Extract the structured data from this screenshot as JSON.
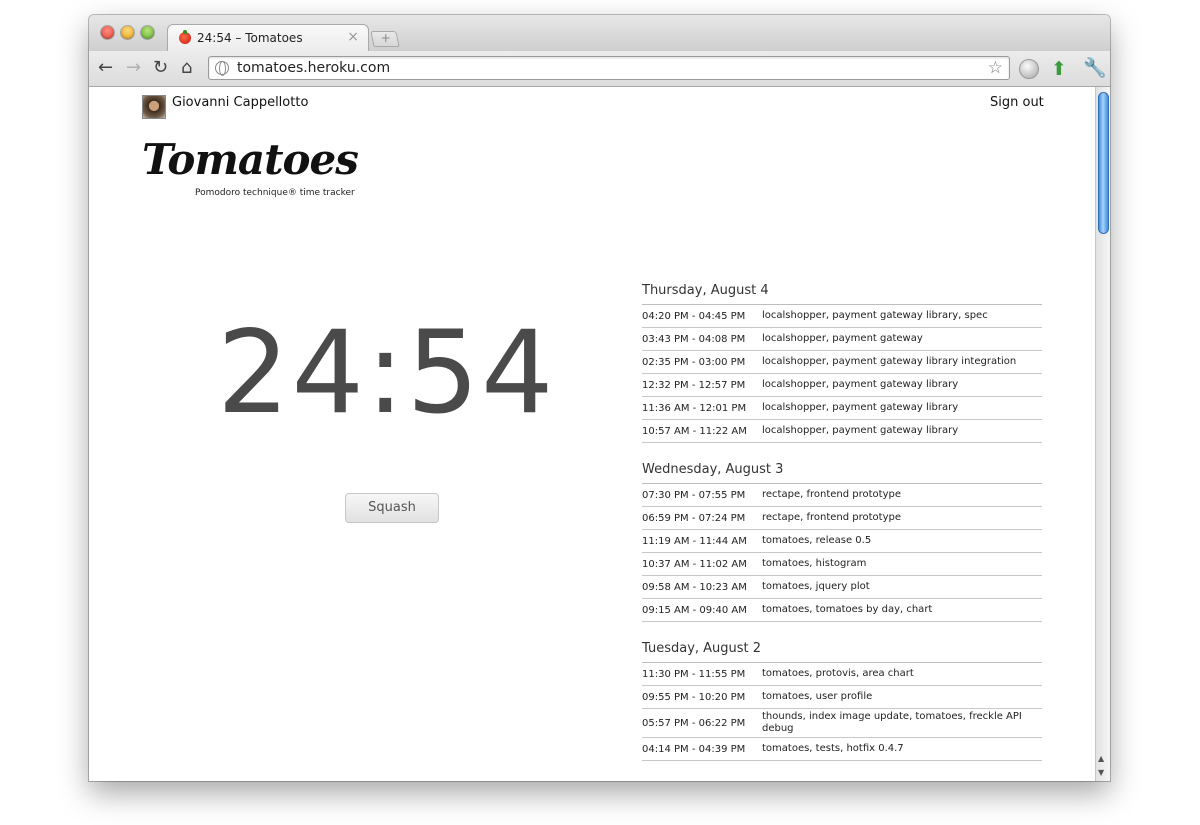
{
  "browser": {
    "tab_title": "24:54 – Tomatoes",
    "tab_close": "×",
    "new_tab": "+",
    "url": "tomatoes.heroku.com",
    "buttons": {
      "back": "←",
      "forward": "→",
      "reload": "↻",
      "home": "⌂",
      "bookmark": "☆",
      "menu": "🔧"
    }
  },
  "header": {
    "user_name": "Giovanni Cappellotto",
    "sign_out": "Sign out",
    "logo": "Tomatoes",
    "tagline": "Pomodoro technique® time tracker"
  },
  "timer": {
    "value": "24:54",
    "squash_label": "Squash"
  },
  "log": [
    {
      "day": "Thursday, August 4",
      "entries": [
        {
          "time": "04:20 PM - 04:45 PM",
          "desc": "localshopper, payment gateway library, spec"
        },
        {
          "time": "03:43 PM - 04:08 PM",
          "desc": "localshopper, payment gateway"
        },
        {
          "time": "02:35 PM - 03:00 PM",
          "desc": "localshopper, payment gateway library integration"
        },
        {
          "time": "12:32 PM - 12:57 PM",
          "desc": "localshopper, payment gateway library"
        },
        {
          "time": "11:36 AM - 12:01 PM",
          "desc": "localshopper, payment gateway library"
        },
        {
          "time": "10:57 AM - 11:22 AM",
          "desc": "localshopper, payment gateway library"
        }
      ]
    },
    {
      "day": "Wednesday, August 3",
      "entries": [
        {
          "time": "07:30 PM - 07:55 PM",
          "desc": "rectape, frontend prototype"
        },
        {
          "time": "06:59 PM - 07:24 PM",
          "desc": "rectape, frontend prototype"
        },
        {
          "time": "11:19 AM - 11:44 AM",
          "desc": "tomatoes, release 0.5"
        },
        {
          "time": "10:37 AM - 11:02 AM",
          "desc": "tomatoes, histogram"
        },
        {
          "time": "09:58 AM - 10:23 AM",
          "desc": "tomatoes, jquery plot"
        },
        {
          "time": "09:15 AM - 09:40 AM",
          "desc": "tomatoes, tomatoes by day, chart"
        }
      ]
    },
    {
      "day": "Tuesday, August 2",
      "entries": [
        {
          "time": "11:30 PM - 11:55 PM",
          "desc": "tomatoes, protovis, area chart"
        },
        {
          "time": "09:55 PM - 10:20 PM",
          "desc": "tomatoes, user profile"
        },
        {
          "time": "05:57 PM - 06:22 PM",
          "desc": "thounds, index image update, tomatoes, freckle API debug"
        },
        {
          "time": "04:14 PM - 04:39 PM",
          "desc": "tomatoes, tests, hotfix 0.4.7"
        }
      ]
    }
  ]
}
